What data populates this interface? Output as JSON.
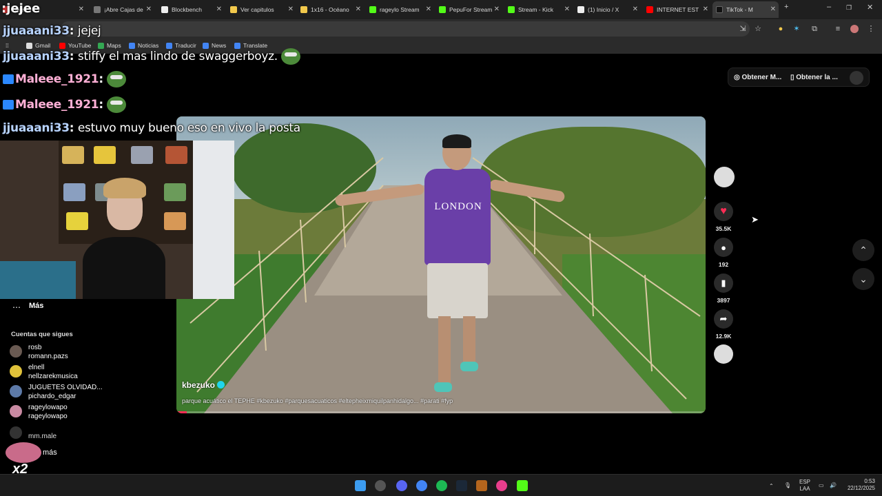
{
  "browser": {
    "tabs": [
      {
        "label": ":jejee",
        "active": false
      },
      {
        "label": "¡Abre Cajas de",
        "active": false
      },
      {
        "label": "Blockbench",
        "active": false
      },
      {
        "label": "Ver capitulos",
        "active": false
      },
      {
        "label": "1x16 - Océano",
        "active": false
      },
      {
        "label": "rageylo Stream",
        "active": false
      },
      {
        "label": "PepuFor Stream",
        "active": false
      },
      {
        "label": "Stream - Kick",
        "active": false
      },
      {
        "label": "(1) Inicio / X",
        "active": false
      },
      {
        "label": "INTERNET EST",
        "active": false
      },
      {
        "label": "TikTok - M",
        "active": true
      }
    ],
    "new_tab": "+",
    "bookmarks": [
      "Gmail",
      "YouTube",
      "Maps",
      "Noticias",
      "Traducir",
      "News",
      "Translate"
    ]
  },
  "chat": {
    "lines": [
      {
        "user": "jjuaaani33",
        "msg": "jejej"
      },
      {
        "user": "jjuaaani33",
        "msg": "stiffy el mas lindo de swaggerboyz."
      },
      {
        "user": "Maleee_1921",
        "msg": ""
      },
      {
        "user": "Maleee_1921",
        "msg": ""
      },
      {
        "user": "jjuaaani33",
        "msg": "estuvo muy bueno eso en vivo la posta"
      }
    ]
  },
  "overlay": {
    "title": ":jejee",
    "badge": "x2"
  },
  "sidebar": {
    "more_label": "Más",
    "following_heading": "Cuentas que sigues",
    "accounts": [
      {
        "name": "rosb",
        "handle": "romann.pazs"
      },
      {
        "name": "elnell",
        "handle": "nellzarekmusica"
      },
      {
        "name": "JUGUETES OLVIDAD...",
        "handle": "pichardo_edgar"
      },
      {
        "name": "rageylowapo",
        "handle": "rageylowapo"
      },
      {
        "name": "",
        "handle": "mm.male"
      }
    ],
    "show_more": "más"
  },
  "top_buttons": {
    "get_coins": "Obtener M...",
    "get_app": "Obtener la ..."
  },
  "video": {
    "author": "kbezuko",
    "caption": "parque acuático el TEPHE #kbezuko #parquesacuaticos #eltepheixmiquilpanhidalgo... #parati #fyp",
    "shirt_text": "LONDON",
    "progress": 0.02
  },
  "actions": {
    "likes": "35.5K",
    "comments": "192",
    "saves": "3897",
    "shares": "12.9K"
  },
  "taskbar": {
    "language_line1": "ESP",
    "language_line2": "LAA",
    "time": "0:53",
    "date": "22/12/2025"
  },
  "colors": {
    "like": "#fe2c55",
    "verified": "#20d5ec",
    "chat_user": "#b7d3ff"
  }
}
